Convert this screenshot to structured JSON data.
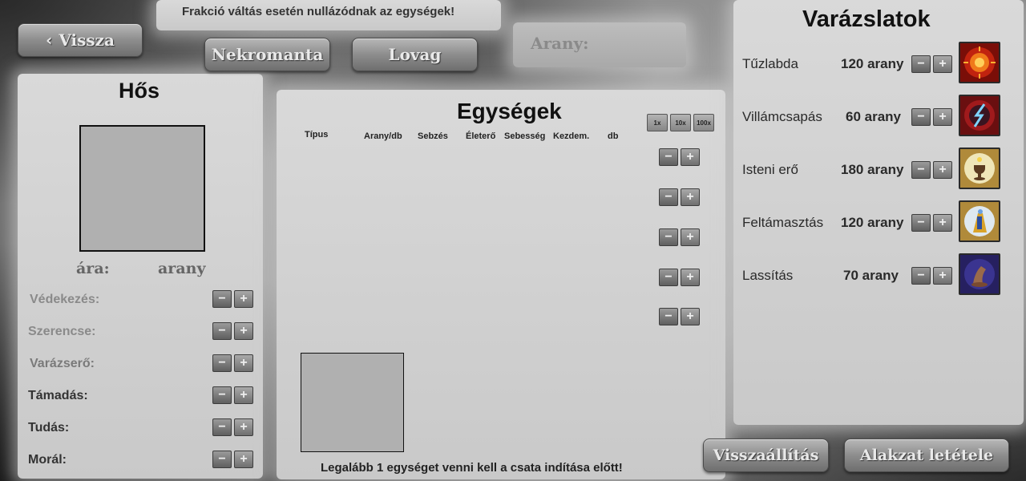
{
  "top": {
    "notice": "Frakció váltás esetén nullázódnak az egységek!",
    "back_label": "Vissza",
    "factions": [
      "Nekromanta",
      "Lovag"
    ],
    "gold_label": "Arany:"
  },
  "hero": {
    "title": "Hős",
    "price_label": "ára:",
    "price_unit": "arany",
    "stats": [
      {
        "label": "Védekezés:",
        "color": "#8a8a8a"
      },
      {
        "label": "Szerencse:",
        "color": "#8a8a8a"
      },
      {
        "label": "Varázserő:",
        "color": "#7a7a7a"
      },
      {
        "label": "Támadás:",
        "color": "#333333"
      },
      {
        "label": "Tudás:",
        "color": "#333333"
      },
      {
        "label": "Morál:",
        "color": "#333333"
      }
    ]
  },
  "units": {
    "title": "Egységek",
    "columns": [
      "Típus",
      "Arany/db",
      "Sebzés",
      "Életerő",
      "Sebesség",
      "Kezdem.",
      "db"
    ],
    "multipliers": [
      "1x",
      "10x",
      "100x"
    ],
    "warning": "Legalább 1 egységet venni kell a csata indítása előtt!"
  },
  "spells": {
    "title": "Varázslatok",
    "items": [
      {
        "name": "Tűzlabda",
        "cost": "120 arany",
        "icon": "fireball-icon"
      },
      {
        "name": "Villámcsapás",
        "cost": "60  arany",
        "icon": "lightning-icon"
      },
      {
        "name": "Isteni erő",
        "cost": "180 arany",
        "icon": "divine-strength-icon"
      },
      {
        "name": "Feltámasztás",
        "cost": "120 arany",
        "icon": "resurrection-icon"
      },
      {
        "name": "Lassítás",
        "cost": "70  arany",
        "icon": "slow-icon"
      }
    ]
  },
  "bottom": {
    "reset_label": "Visszaállítás",
    "place_label": "Alakzat letétele"
  },
  "controls": {
    "minus": "−",
    "plus": "+"
  }
}
